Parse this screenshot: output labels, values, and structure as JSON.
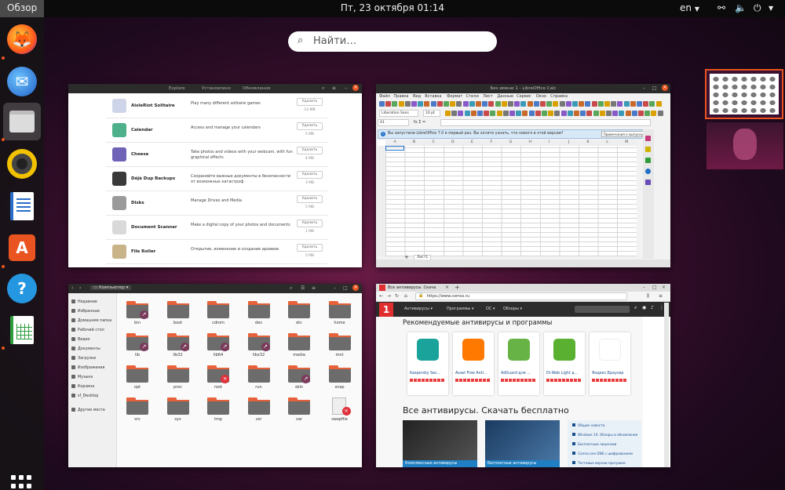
{
  "topbar": {
    "activities": "Обзор",
    "clock": "Пт, 23 октября  01:14",
    "lang": "en"
  },
  "dock": {
    "apps": [
      {
        "name": "Firefox",
        "color": "#ff7a1a",
        "active": false,
        "running": true
      },
      {
        "name": "Thunderbird",
        "color": "#1e78d7",
        "active": false,
        "running": false
      },
      {
        "name": "Files",
        "color": "#8a8a8a",
        "active": true,
        "running": true
      },
      {
        "name": "Rhythmbox",
        "color": "#f2c200",
        "active": false,
        "running": false
      },
      {
        "name": "LibreOffice Writer",
        "color": "#2a6ec9",
        "active": false,
        "running": false
      },
      {
        "name": "Ubuntu Software",
        "color": "#e95420",
        "active": false,
        "running": true
      },
      {
        "name": "Help",
        "color": "#2596e0",
        "active": false,
        "running": false
      },
      {
        "name": "LibreOffice Calc",
        "color": "#2f9d3d",
        "active": false,
        "running": true
      }
    ]
  },
  "search": {
    "placeholder": "Найти…"
  },
  "software": {
    "tabs": [
      "Explore",
      "Установлено",
      "Обновления"
    ],
    "rows": [
      {
        "name": "AisleRiot Solitaire",
        "desc": "Play many different solitaire games",
        "button": "Удалить",
        "size": "14 MB",
        "color": "#cfd5e8"
      },
      {
        "name": "Calendar",
        "desc": "Access and manage your calendars",
        "button": "Удалить",
        "size": "5 MB",
        "color": "#4fb08c"
      },
      {
        "name": "Cheese",
        "desc": "Take photos and videos with your webcam, with fun graphical effects",
        "button": "Удалить",
        "size": "4 MB",
        "color": "#6f63b8"
      },
      {
        "name": "Déjà Dup Backups",
        "desc": "Сохраняйте важные документы в безопасности от возможных катастроф",
        "button": "Удалить",
        "size": "3 MB",
        "color": "#3a3a3a"
      },
      {
        "name": "Disks",
        "desc": "Manage Drives and Media",
        "button": "Удалить",
        "size": "5 MB",
        "color": "#9a9a9a"
      },
      {
        "name": "Document Scanner",
        "desc": "Make a digital copy of your photos and documents",
        "button": "Удалить",
        "size": "1 MB",
        "color": "#d9d9d9"
      },
      {
        "name": "File Roller",
        "desc": "Открытие, изменение и создание архивов",
        "button": "Удалить",
        "size": "5 MB",
        "color": "#c9b48a"
      }
    ]
  },
  "calc": {
    "title": "Без имени 1 - LibreOffice Calc",
    "menu": [
      "Файл",
      "Правка",
      "Вид",
      "Вставка",
      "Формат",
      "Стили",
      "Лист",
      "Данные",
      "Сервис",
      "Окно",
      "Справка"
    ],
    "font": "Liberation Sans",
    "font_size": "10 pt",
    "cell_ref": "A1",
    "info": "Вы запустили LibreOffice 7.0 в первый раз. Вы хотите узнать, что нового в этой версии?",
    "info_button": "Примечания к выпуску",
    "columns": [
      "A",
      "B",
      "C",
      "D",
      "E",
      "F",
      "G",
      "H",
      "I",
      "J",
      "K",
      "L",
      "M"
    ],
    "sheet_tab": "Лист1"
  },
  "files": {
    "location": "Компьютер",
    "sidebar": [
      "Недавние",
      "Избранные",
      "Домашняя папка",
      "Рабочий стол",
      "Видео",
      "Документы",
      "Загрузки",
      "Изображения",
      "Музыка",
      "Корзина",
      "sf_Desktop",
      "Другие места"
    ],
    "folders": [
      {
        "name": "bin",
        "badge": "link"
      },
      {
        "name": "boot",
        "badge": ""
      },
      {
        "name": "cdrom",
        "badge": ""
      },
      {
        "name": "dev",
        "badge": ""
      },
      {
        "name": "etc",
        "badge": ""
      },
      {
        "name": "home",
        "badge": ""
      },
      {
        "name": "lib",
        "badge": "link"
      },
      {
        "name": "lib32",
        "badge": "link"
      },
      {
        "name": "lib64",
        "badge": "link"
      },
      {
        "name": "libx32",
        "badge": "link"
      },
      {
        "name": "media",
        "badge": ""
      },
      {
        "name": "mnt",
        "badge": ""
      },
      {
        "name": "opt",
        "badge": ""
      },
      {
        "name": "proc",
        "badge": ""
      },
      {
        "name": "root",
        "badge": "lock"
      },
      {
        "name": "run",
        "badge": ""
      },
      {
        "name": "sbin",
        "badge": "link"
      },
      {
        "name": "snap",
        "badge": ""
      },
      {
        "name": "srv",
        "badge": ""
      },
      {
        "name": "sys",
        "badge": ""
      },
      {
        "name": "tmp",
        "badge": ""
      },
      {
        "name": "usr",
        "badge": ""
      },
      {
        "name": "var",
        "badge": ""
      },
      {
        "name": "swapfile",
        "badge": "lock"
      }
    ]
  },
  "browser": {
    "tab": "Все антивирусы. Скача",
    "url": "https://www.comss.ru",
    "nav": [
      "Антивирусы",
      "Программы",
      "ОС",
      "Обзоры"
    ],
    "heading1": "Рекомендуемые антивирусы и программы",
    "cards": [
      {
        "name": "Kaspersky Sec...",
        "color": "#1aa39a"
      },
      {
        "name": "Avast Free Anti...",
        "color": "#ff7800"
      },
      {
        "name": "AdGuard для ...",
        "color": "#67b346"
      },
      {
        "name": "Dr.Web Light д...",
        "color": "#59b031"
      },
      {
        "name": "Яндекс.Браузер",
        "color": "#ffffff"
      }
    ],
    "heading2": "Все антивирусы. Скачать бесплатно",
    "thumbs": [
      "Комплексные антивирусы",
      "Бесплатные антивирусы"
    ],
    "side_links": [
      "Общие новости",
      "Windows 10. Обзоры и обновления",
      "Бесплатные лицензии",
      "Comss.one DNS с шифрованием",
      "Тестовые версии программ"
    ]
  }
}
